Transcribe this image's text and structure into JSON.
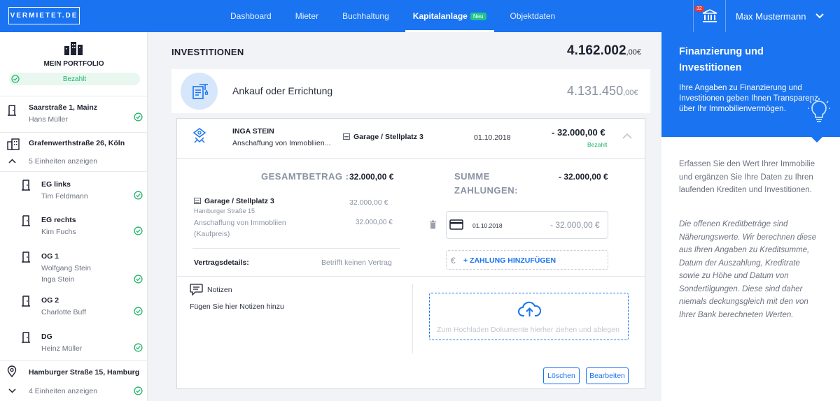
{
  "nav": {
    "logo": "VERMIETET.DE",
    "items": [
      {
        "label": "Dashboard"
      },
      {
        "label": "Mieter"
      },
      {
        "label": "Buchhaltung"
      },
      {
        "label": "Kapitalanlage",
        "badge": "Neu",
        "active": true
      },
      {
        "label": "Objektdaten"
      }
    ],
    "notification_count": "32",
    "user_name": "Max Mustermann"
  },
  "sidebar": {
    "portfolio_title": "MEIN PORTFOLIO",
    "portfolio_status": "Bezahlt",
    "properties": [
      {
        "address": "Saarstraße 1, Mainz",
        "tenant": "Hans Müller"
      },
      {
        "address": "Grafenwerthstraße 26, Köln",
        "toggle": "5 Einheiten anzeigen",
        "units": [
          {
            "name": "EG links",
            "tenants": [
              "Tim Feldmann"
            ]
          },
          {
            "name": "EG rechts",
            "tenants": [
              "Kim Fuchs"
            ]
          },
          {
            "name": "OG 1",
            "tenants": [
              "Wolfgang Stein",
              "Inga Stein"
            ]
          },
          {
            "name": "OG 2",
            "tenants": [
              "Charlotte Buff"
            ]
          },
          {
            "name": "DG",
            "tenants": [
              "Heinz Müller"
            ]
          }
        ]
      },
      {
        "address": "Hamburger Straße 15, Hamburg",
        "toggle": "4 Einheiten anzeigen"
      }
    ]
  },
  "main": {
    "title": "INVESTITIONEN",
    "total_main": "4.162.002",
    "total_cents": ",00€",
    "category": {
      "label": "Ankauf oder Errichtung",
      "amount_main": "4.131.450",
      "amount_cents": ",00€"
    },
    "entry": {
      "name": "INGA STEIN",
      "description": "Anschaffung von Immobliien...",
      "object": "Garage / Stellplatz 3",
      "date": "01.10.2018",
      "amount": "- 32.000,00 €",
      "status": "Bezahlt"
    },
    "detail": {
      "gesamt_label": "GESAMTBETRAG :",
      "gesamt_value": "32.000,00 €",
      "summe_label_1": "SUMME",
      "summe_label_2": "ZAHLUNGEN:",
      "summe_value": "- 32.000,00 €",
      "item_title": "Garage / Stellplatz 3",
      "item_address": "Hamburger Straße 15",
      "item_amount": "32.000,00 €",
      "item_desc_1": "Anschaffung von Immobliien",
      "item_desc_2": "(Kaufpreis)",
      "item_desc_amount": "32.000,00 €",
      "vertrag_label": "Vertragsdetails:",
      "vertrag_value": "Betrifft keinen Vertrag",
      "payment_date": "01.10.2018",
      "payment_amount": "- 32.000,00 €",
      "add_payment": "+ ZAHLUNG HINZUFÜGEN",
      "notes_title": "Notizen",
      "notes_placeholder": "Fügen Sie hier Notizen hinzu",
      "upload_text": "Zum Hochladen Dokumente hierher ziehen und ablegen",
      "delete_label": "Löschen",
      "edit_label": "Bearbeiten"
    }
  },
  "info_panel": {
    "title": "Finanzierung und Investitionen",
    "subtitle": "Ihre Angaben zu Finanzierung und Investitionen geben Ihnen Transparenz über Ihr Immobilienvermögen.",
    "text1": "Erfassen Sie den Wert Ihrer Immobilie und ergänzen Sie Ihre Daten zu Ihren laufenden Krediten und Investitionen.",
    "text2": "Die offenen Kreditbeträge sind Näherungswerte. Wir berechnen diese aus Ihren Angaben zu Kreditsumme, Datum der Auszahlung, Kreditrate sowie zu Höhe und Datum von Sondertilgungen. Diese sind daher niemals deckungsgleich mit den von Ihrer Bank berechneten Werten."
  },
  "colors": {
    "primary": "#1a73f0",
    "success": "#21b36b",
    "muted": "#8a93a3"
  }
}
